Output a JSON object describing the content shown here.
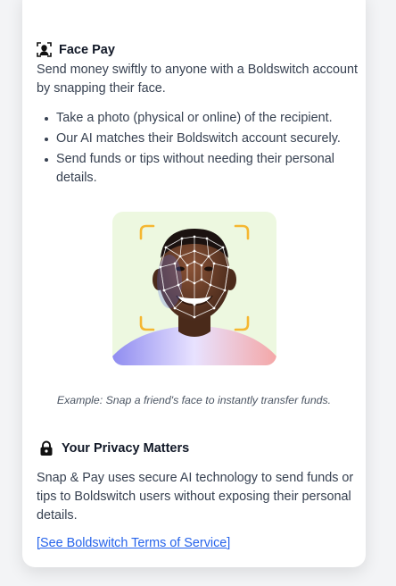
{
  "face_pay": {
    "title": "Face Pay",
    "description": "Send money swiftly to anyone with a Boldswitch account by snapping their face.",
    "bullets": [
      "Take a photo (physical or online) of the recipient.",
      "Our AI matches their Boldswitch account securely.",
      "Send funds or tips without needing their personal details."
    ],
    "caption": "Example: Snap a friend's face to instantly transfer funds.",
    "icon": "face-scan-icon"
  },
  "privacy": {
    "title": "Your Privacy Matters",
    "description": "Snap & Pay uses secure AI technology to send funds or tips to Boldswitch users without exposing their personal details.",
    "link_text": "[See Boldswitch Terms of Service]",
    "icon": "lock-icon"
  },
  "colors": {
    "accent_link": "#2563eb",
    "scan_corner": "#f5b731",
    "photo_bg": "#edf8e0"
  }
}
